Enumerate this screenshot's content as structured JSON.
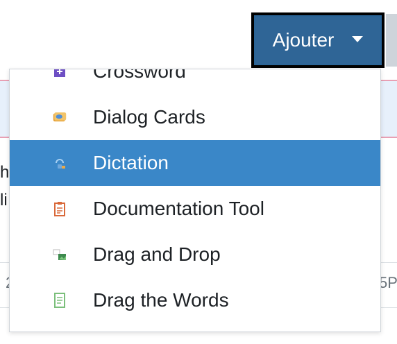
{
  "header": {
    "add_button_label": "Ajouter"
  },
  "background": {
    "text_left_1": "hi",
    "text_left_2": "li",
    "text_right_sort": "↕",
    "row_cell_left": "2",
    "row_cell_right": "5P"
  },
  "menu": {
    "items": [
      {
        "label": "Crossword",
        "icon": "crossword-icon",
        "active": false
      },
      {
        "label": "Dialog Cards",
        "icon": "dialog-cards-icon",
        "active": false
      },
      {
        "label": "Dictation",
        "icon": "dictation-icon",
        "active": true
      },
      {
        "label": "Documentation Tool",
        "icon": "documentation-tool-icon",
        "active": false
      },
      {
        "label": "Drag and Drop",
        "icon": "drag-and-drop-icon",
        "active": false
      },
      {
        "label": "Drag the Words",
        "icon": "drag-the-words-icon",
        "active": false
      }
    ]
  },
  "colors": {
    "button_bg": "#2f6596",
    "active_item_bg": "#3a87c8"
  }
}
